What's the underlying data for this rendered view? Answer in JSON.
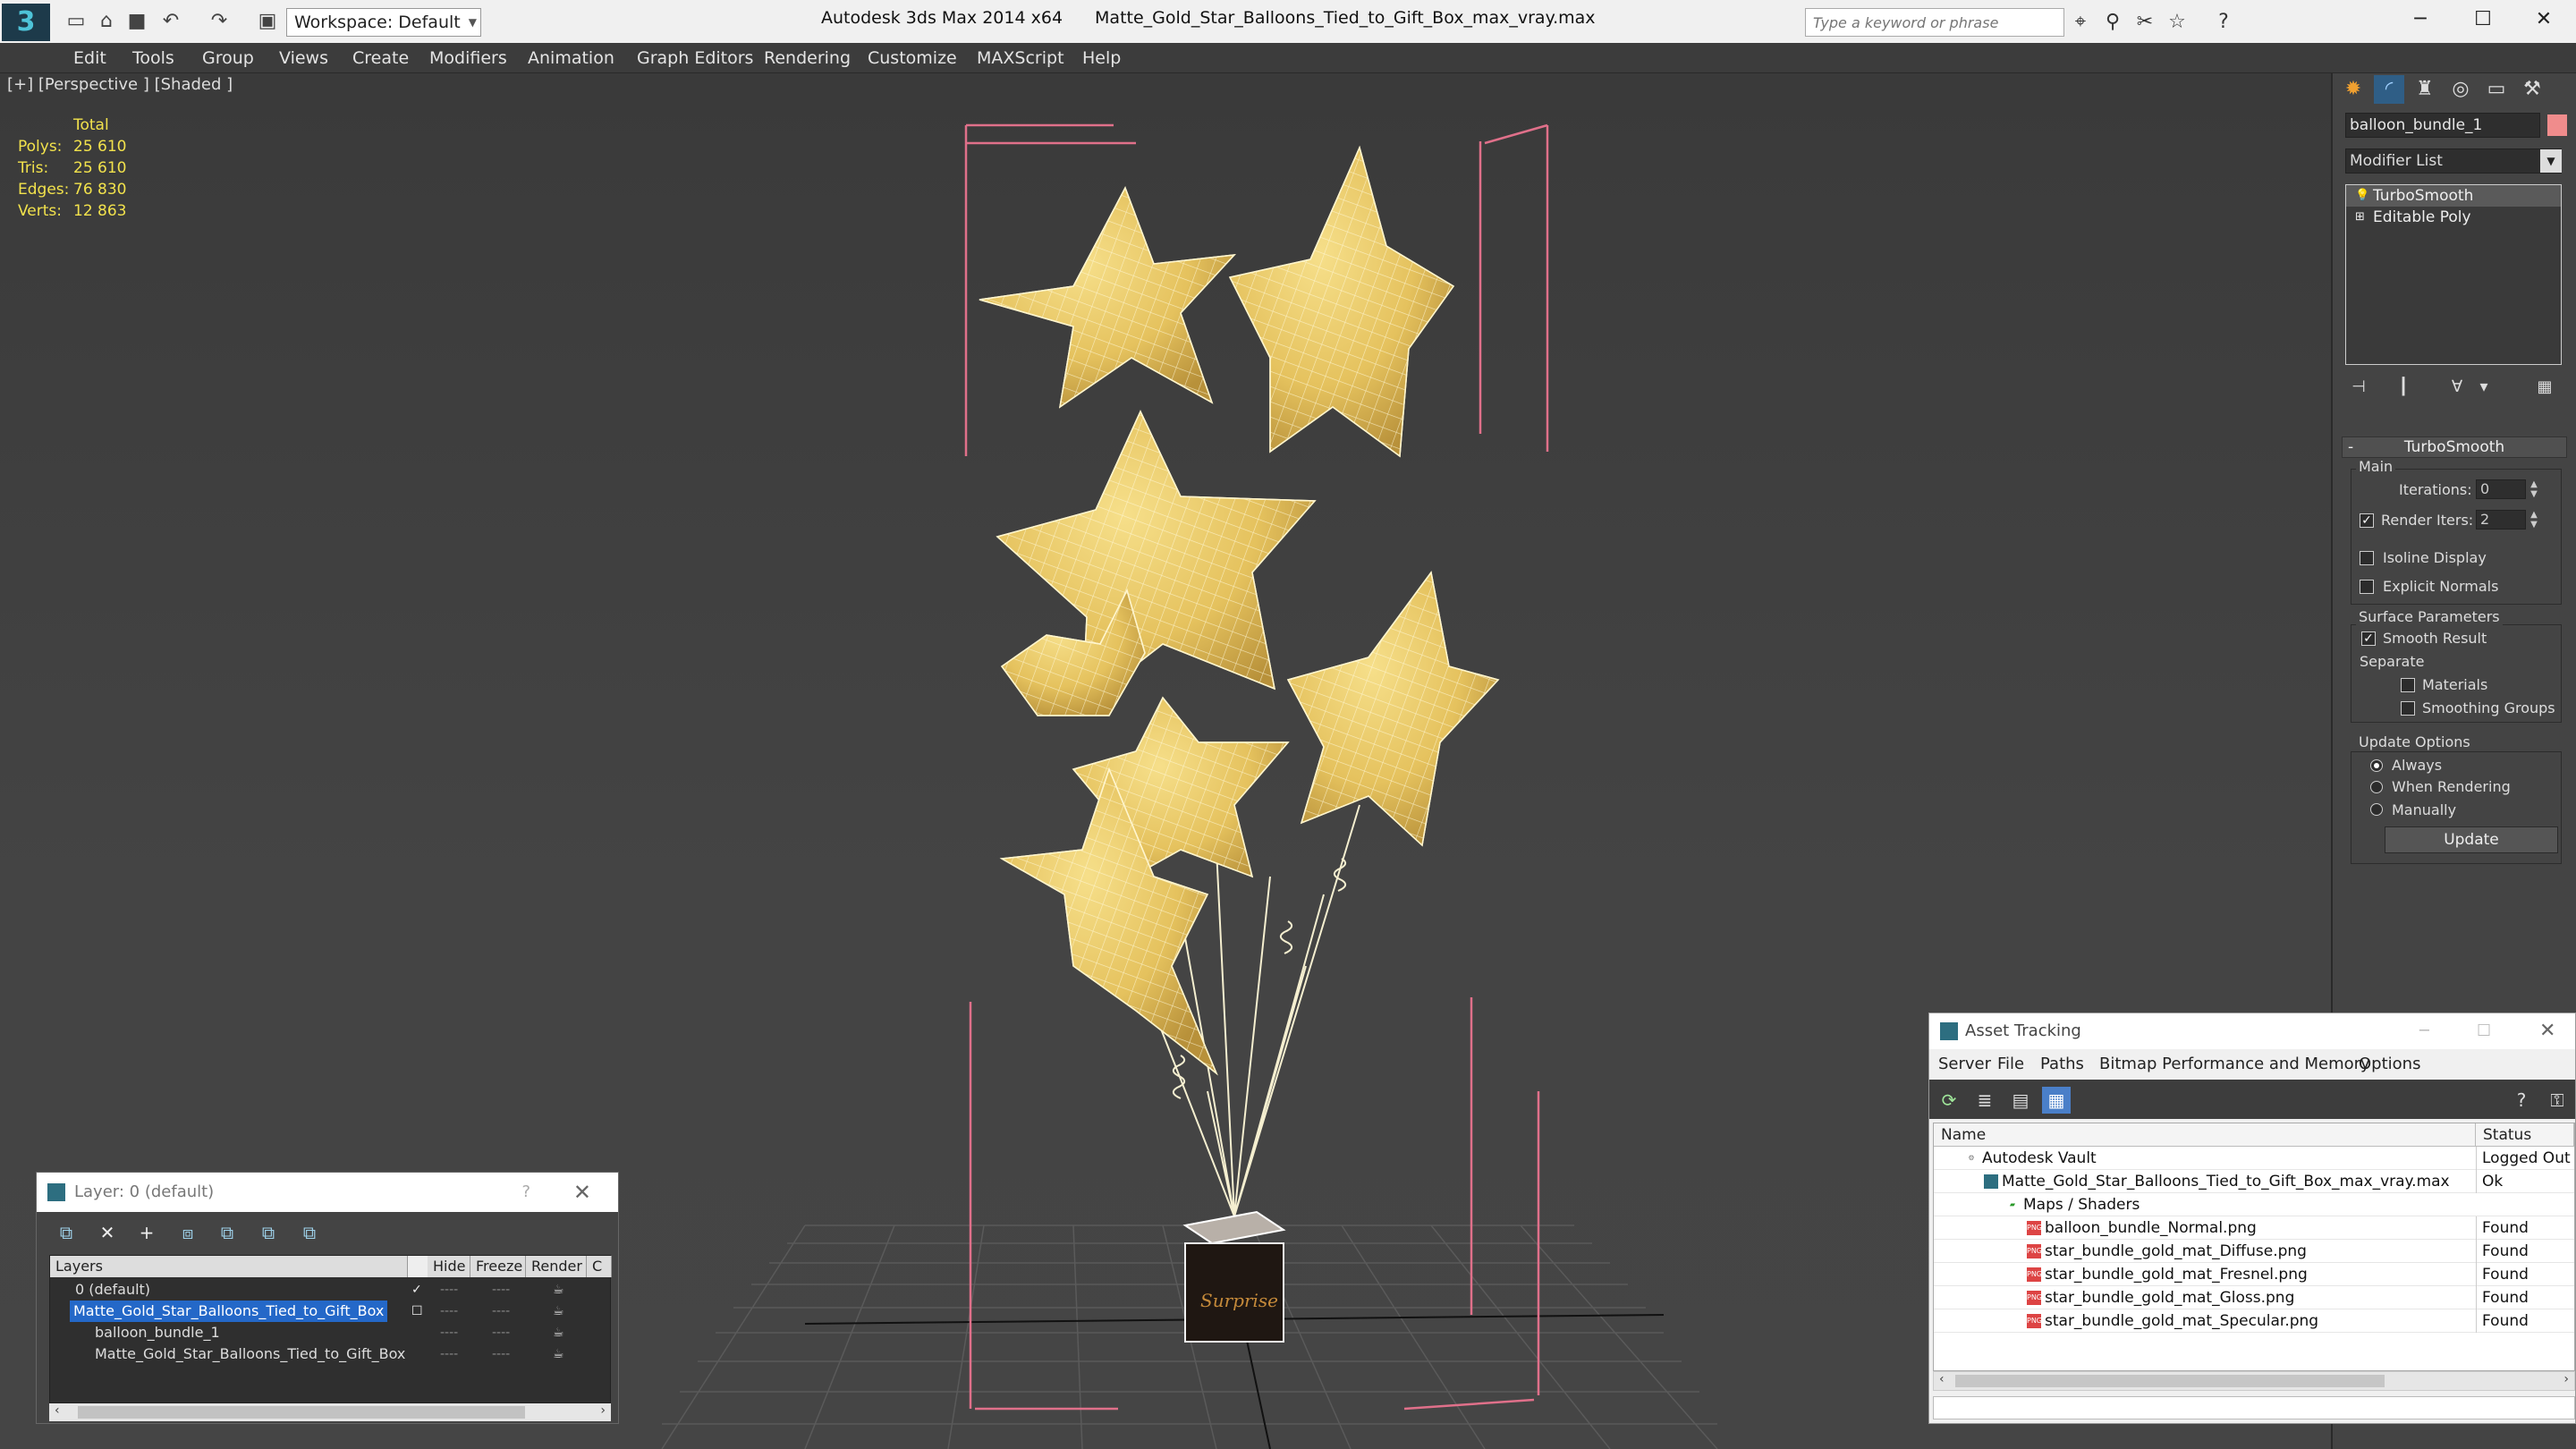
{
  "titlebar": {
    "workspace": "Workspace: Default",
    "app_title": "Autodesk 3ds Max  2014 x64",
    "file_title": "Matte_Gold_Star_Balloons_Tied_to_Gift_Box_max_vray.max",
    "search_placeholder": "Type a keyword or phrase"
  },
  "menu": [
    "Edit",
    "Tools",
    "Group",
    "Views",
    "Create",
    "Modifiers",
    "Animation",
    "Graph Editors",
    "Rendering",
    "Customize",
    "MAXScript",
    "Help"
  ],
  "viewport": {
    "label": "[+] [Perspective ] [Shaded ]",
    "stats": {
      "total_label": "Total",
      "rows": [
        {
          "key": "Polys:",
          "value": "25 610"
        },
        {
          "key": "Tris:",
          "value": "25 610"
        },
        {
          "key": "Edges:",
          "value": "76 830"
        },
        {
          "key": "Verts:",
          "value": "12 863"
        }
      ]
    },
    "box_text": "Surprise"
  },
  "command_panel": {
    "object_name": "balloon_bundle_1",
    "object_color": "#f08c8c",
    "modifier_list": "Modifier List",
    "stack": [
      "TurboSmooth",
      "Editable Poly"
    ],
    "rollout": "TurboSmooth",
    "main_group": "Main",
    "iterations_label": "Iterations:",
    "iterations_value": "0",
    "render_iters_label": "Render Iters:",
    "render_iters_value": "2",
    "isoline": "Isoline Display",
    "explicit_normals": "Explicit Normals",
    "surface_group": "Surface Parameters",
    "smooth_result": "Smooth Result",
    "separate": "Separate",
    "materials": "Materials",
    "smoothing_groups": "Smoothing Groups",
    "update_group": "Update Options",
    "always": "Always",
    "when_rendering": "When Rendering",
    "manually": "Manually",
    "update_button": "Update"
  },
  "layer_dialog": {
    "title": "Layer: 0 (default)",
    "question": "?",
    "columns": {
      "layers": "Layers",
      "hide": "Hide",
      "freeze": "Freeze",
      "render": "Render",
      "c": "C"
    },
    "rows": [
      {
        "name": "0 (default)",
        "dash": "----"
      },
      {
        "name": "Matte_Gold_Star_Balloons_Tied_to_Gift_Box",
        "dash": "----"
      },
      {
        "name": "balloon_bundle_1",
        "dash": "----"
      },
      {
        "name": "Matte_Gold_Star_Balloons_Tied_to_Gift_Box",
        "dash": "----"
      }
    ]
  },
  "asset_dialog": {
    "title": "Asset Tracking",
    "menu": [
      "Server",
      "File",
      "Paths",
      "Bitmap Performance and Memory",
      "Options"
    ],
    "columns": {
      "name": "Name",
      "status": "Status"
    },
    "rows": [
      {
        "name": "Autodesk Vault",
        "status": "Logged Out ..."
      },
      {
        "name": "Matte_Gold_Star_Balloons_Tied_to_Gift_Box_max_vray.max",
        "status": "Ok"
      },
      {
        "name": "Maps / Shaders",
        "status": ""
      },
      {
        "name": "balloon_bundle_Normal.png",
        "status": "Found"
      },
      {
        "name": "star_bundle_gold_mat_Diffuse.png",
        "status": "Found"
      },
      {
        "name": "star_bundle_gold_mat_Fresnel.png",
        "status": "Found"
      },
      {
        "name": "star_bundle_gold_mat_Gloss.png",
        "status": "Found"
      },
      {
        "name": "star_bundle_gold_mat_Specular.png",
        "status": "Found"
      }
    ],
    "png_badge": "PNG"
  }
}
